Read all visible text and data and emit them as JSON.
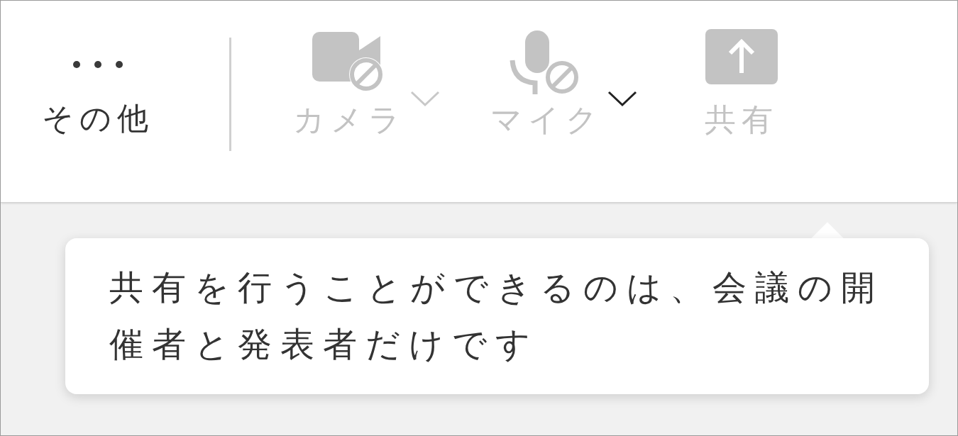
{
  "toolbar": {
    "items": [
      {
        "kind": "more",
        "label": "その他",
        "disabled": false
      },
      {
        "kind": "camera",
        "label": "カメラ",
        "disabled": true,
        "menu": {
          "disabled": true
        }
      },
      {
        "kind": "mic",
        "label": "マイク",
        "disabled": true,
        "menu": {
          "disabled": false
        }
      },
      {
        "kind": "share",
        "label": "共有",
        "disabled": true
      }
    ]
  },
  "tooltip": {
    "text": "共有を行うことができるのは、会議の開催者と発表者だけです"
  }
}
